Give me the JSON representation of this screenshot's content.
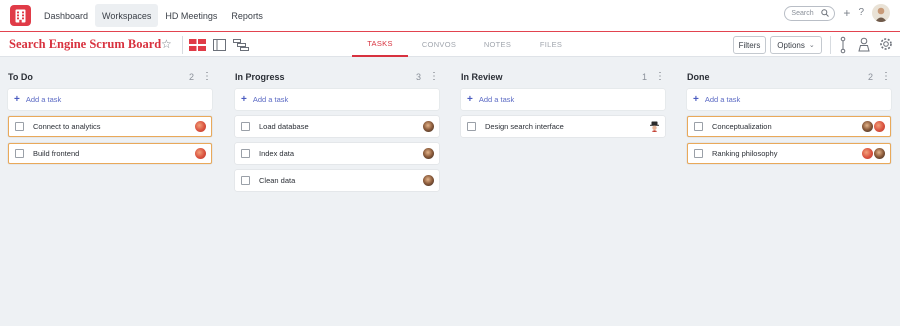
{
  "nav": {
    "links": [
      "Dashboard",
      "Workspaces",
      "HD Meetings",
      "Reports"
    ],
    "search_placeholder": "Search"
  },
  "board": {
    "title": "Search Engine Scrum Board",
    "tabs": [
      "TASKS",
      "CONVOS",
      "NOTES",
      "FILES"
    ],
    "filters_label": "Filters",
    "options_label": "Options"
  },
  "colors": {
    "brand": "#e03b47",
    "accent_link": "#4a5bc0",
    "highlight_border": "#e9a95a"
  },
  "columns": [
    {
      "title": "To Do",
      "count": "2",
      "add_label": "Add a task",
      "tasks": [
        {
          "label": "Connect to analytics",
          "highlighted": true
        },
        {
          "label": "Build frontend",
          "highlighted": true
        }
      ]
    },
    {
      "title": "In Progress",
      "count": "3",
      "add_label": "Add a task",
      "tasks": [
        {
          "label": "Load database",
          "highlighted": false
        },
        {
          "label": "Index data",
          "highlighted": false
        },
        {
          "label": "Clean data",
          "highlighted": false
        }
      ]
    },
    {
      "title": "In Review",
      "count": "1",
      "add_label": "Add a task",
      "tasks": [
        {
          "label": "Design search interface",
          "highlighted": false
        }
      ]
    },
    {
      "title": "Done",
      "count": "2",
      "add_label": "Add a task",
      "tasks": [
        {
          "label": "Conceptualization",
          "highlighted": true
        },
        {
          "label": "Ranking philosophy",
          "highlighted": true
        }
      ]
    }
  ]
}
